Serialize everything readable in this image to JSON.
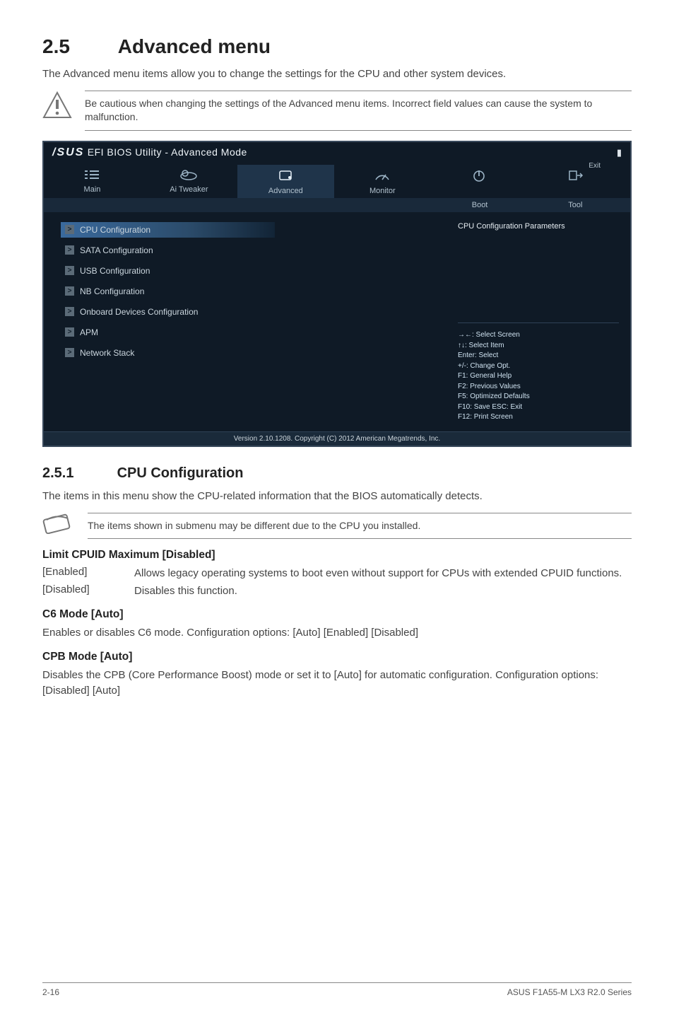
{
  "section": {
    "number": "2.5",
    "title": "Advanced menu",
    "intro": "The Advanced menu items allow you to change the settings for the CPU and other system devices.",
    "caution": "Be cautious when changing the settings of the Advanced menu items. Incorrect field values can cause the system to malfunction."
  },
  "bios": {
    "logo_brand": "/SUS",
    "logo_suffix": "EFI BIOS Utility - Advanced Mode",
    "flag_icon": "▮",
    "exit_label": "Exit",
    "tabs_row1": [
      "Main",
      "Ai Tweaker",
      "Advanced",
      "Monitor",
      "",
      ""
    ],
    "tabs_row1_active_index": 2,
    "tabs_row2": [
      "Boot",
      "Tool"
    ],
    "tab_icons": {
      "main": "list-icon",
      "ai_tweaker": "cloud-icon",
      "advanced": "chip-icon",
      "monitor": "gauge-icon",
      "power": "power-icon",
      "exit": "exit-icon"
    },
    "menu_items": [
      "CPU Configuration",
      "SATA Configuration",
      "USB Configuration",
      "NB Configuration",
      "Onboard Devices Configuration",
      "APM",
      "Network Stack"
    ],
    "selected_menu_index": 0,
    "right_panel_title": "CPU Configuration Parameters",
    "help_lines": [
      "→←: Select Screen",
      "↑↓: Select Item",
      "Enter: Select",
      "+/-: Change Opt.",
      "F1: General Help",
      "F2: Previous Values",
      "F5: Optimized Defaults",
      "F10: Save   ESC: Exit",
      "F12: Print Screen"
    ],
    "footer": "Version 2.10.1208.   Copyright (C) 2012 American Megatrends, Inc."
  },
  "subsection": {
    "number": "2.5.1",
    "title": "CPU Configuration",
    "intro": "The items in this menu show the CPU-related information that the BIOS automatically detects.",
    "info_note": "The items shown in submenu may be different due to the CPU you installed."
  },
  "items": {
    "limit_cpuid": {
      "heading": "Limit CPUID Maximum [Disabled]",
      "defs": [
        {
          "term": "[Enabled]",
          "desc": "Allows legacy operating systems to boot even without support for CPUs with extended CPUID functions."
        },
        {
          "term": "[Disabled]",
          "desc": "Disables this function."
        }
      ]
    },
    "c6": {
      "heading": "C6 Mode [Auto]",
      "text": "Enables or disables C6 mode. Configuration options: [Auto] [Enabled] [Disabled]"
    },
    "cpb": {
      "heading": "CPB Mode [Auto]",
      "text": "Disables the CPB (Core Performance Boost) mode or set it to [Auto] for automatic configuration. Configuration options: [Disabled] [Auto]"
    }
  },
  "footer": {
    "left": "2-16",
    "right": "ASUS F1A55-M LX3 R2.0 Series"
  }
}
